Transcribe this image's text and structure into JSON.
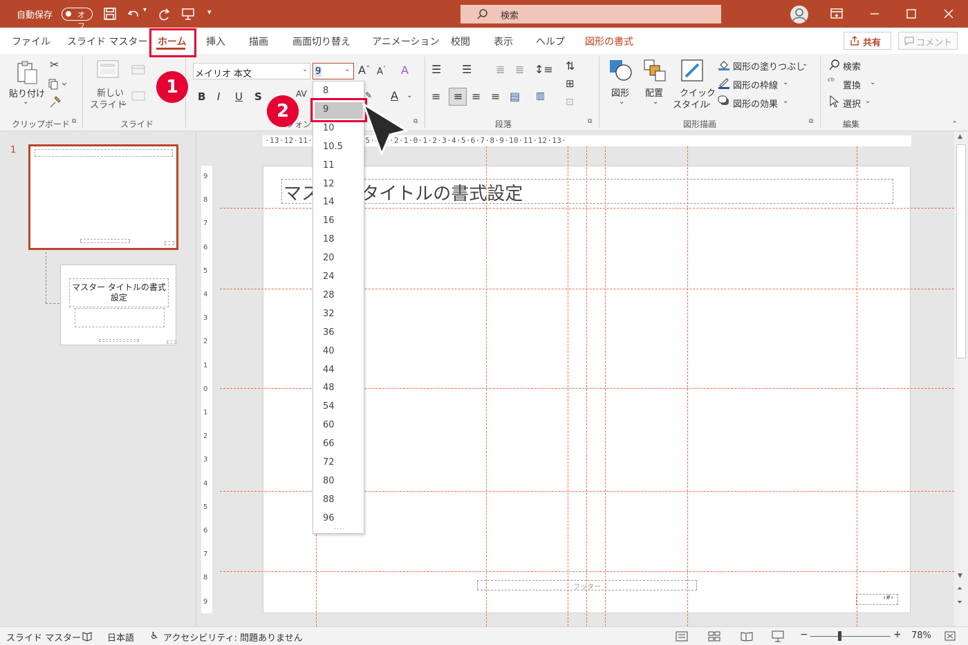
{
  "titlebar": {
    "autosave_label": "自動保存",
    "autosave_state": "オフ",
    "search_placeholder": "検索"
  },
  "tabs": [
    "ファイル",
    "スライド マスター",
    "ホーム",
    "挿入",
    "描画",
    "画面切り替え",
    "アニメーション",
    "校閲",
    "表示",
    "ヘルプ",
    "図形の書式"
  ],
  "share_label": "共有",
  "comment_label": "コメント",
  "ribbon": {
    "paste": "貼り付け",
    "new_slide_1": "新しい",
    "new_slide_2": "スライド",
    "font_name": "メイリオ 本文",
    "font_size": "9",
    "shape": "図形",
    "arrange": "配置",
    "quick_style_1": "クイック",
    "quick_style_2": "スタイル",
    "fill": "図形の塗りつぶし",
    "outline": "図形の枠線",
    "effect": "図形の効果",
    "find": "検索",
    "replace": "置換",
    "select": "選択",
    "groups": {
      "clipboard": "クリップボード",
      "slide": "スライド",
      "font": "フォント",
      "paragraph": "段落",
      "drawing": "図形描画",
      "editing": "編集"
    }
  },
  "font_sizes": [
    "8",
    "9",
    "10",
    "10.5",
    "11",
    "12",
    "14",
    "16",
    "18",
    "20",
    "24",
    "28",
    "32",
    "36",
    "40",
    "44",
    "48",
    "54",
    "60",
    "66",
    "72",
    "80",
    "88",
    "96"
  ],
  "thumbs": {
    "number": "1",
    "layout_title": "マスター タイトルの書式設定"
  },
  "slide": {
    "title": "マスター タイトルの書式設定",
    "footer": "フッター",
    "page_number": "‹#›"
  },
  "ruler_h": "·13·12·11·10·9·8·7·6·5·4·3·2·1·0·1·2·3·4·5·6·7·8·9·10·11·12·13·",
  "ruler_v": [
    "9",
    "8",
    "7",
    "6",
    "5",
    "4",
    "3",
    "2",
    "1",
    "0",
    "1",
    "2",
    "3",
    "4",
    "5",
    "6",
    "7",
    "8",
    "9"
  ],
  "status": {
    "view": "スライド マスター",
    "language": "日本語",
    "accessibility": "アクセシビリティ: 問題ありません",
    "zoom": "78%"
  },
  "annotations": {
    "step1": "1",
    "step2": "2"
  },
  "colors": {
    "accent": "#b7472a",
    "callout": "#e60033",
    "guide": "#ef6c4a"
  }
}
